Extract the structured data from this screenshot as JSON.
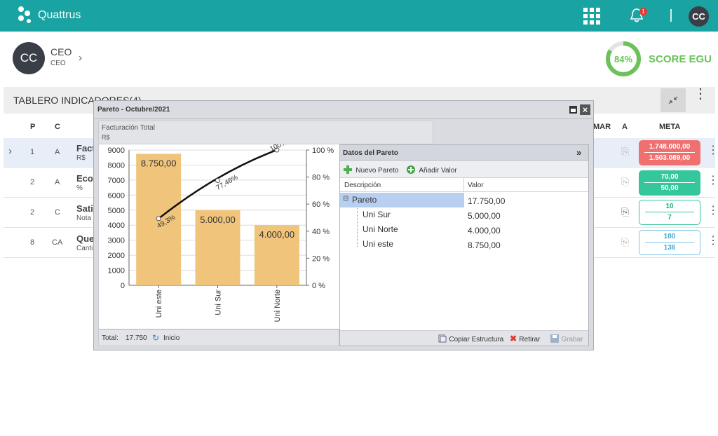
{
  "topbar": {
    "app_name": "Quattrus",
    "notification_count": "1",
    "user_initials": "CC"
  },
  "profile": {
    "initials": "CC",
    "name": "CEO",
    "role": "CEO",
    "chevron": "›"
  },
  "score": {
    "value": "84%",
    "label": "SCORE EGU",
    "fraction": 0.84,
    "color": "#6ac259"
  },
  "dashboard": {
    "title": "TABLERO INDICADORES(4)"
  },
  "table": {
    "headers": {
      "p": "P",
      "c": "C",
      "mar": "MAR",
      "a": "A",
      "meta": "META"
    },
    "rows": [
      {
        "expand": "›",
        "p": "1",
        "c": "A",
        "name": "Fact",
        "unit": "R$",
        "meta_top": "1.748.000,00",
        "meta_bottom": "1.503.089,00"
      },
      {
        "p": "2",
        "c": "A",
        "name": "Econ",
        "unit": "%",
        "meta_top": "70,00",
        "meta_bottom": "50,00"
      },
      {
        "p": "2",
        "c": "C",
        "name": "Satis",
        "unit": "Nota",
        "meta_top": "10",
        "meta_bottom": "7"
      },
      {
        "p": "8",
        "c": "CA",
        "name": "Quej",
        "unit": "Canti",
        "meta_top": "180",
        "meta_bottom": "136"
      }
    ]
  },
  "modal": {
    "title": "Pareto - Octubre/2021",
    "chart_title": "Facturación Total",
    "chart_unit": "R$",
    "footer_total_label": "Total:",
    "footer_total_value": "17.750",
    "footer_inicio": "Inicio",
    "panel": {
      "title": "Datos del Pareto",
      "collapse": "»",
      "btn_new": "Nuevo Pareto",
      "btn_add": "Añadir Valor",
      "col_desc": "Descripción",
      "col_val": "Valor",
      "tree": [
        {
          "label": "Pareto",
          "value": "17.750,00"
        },
        {
          "label": "Uni Sur",
          "value": "5.000,00"
        },
        {
          "label": "Uni Norte",
          "value": "4.000,00"
        },
        {
          "label": "Uni este",
          "value": "8.750,00"
        }
      ],
      "btn_copy": "Copiar Estructura",
      "btn_remove": "Retirar",
      "btn_save": "Grabar"
    }
  },
  "chart_data": {
    "type": "bar",
    "categories": [
      "Uni este",
      "Uni Sur",
      "Uni Norte"
    ],
    "values": [
      8750,
      5000,
      4000
    ],
    "value_labels": [
      "8.750,00",
      "5.000,00",
      "4.000,00"
    ],
    "cumulative_pct": [
      49.3,
      77.46,
      100
    ],
    "cumulative_labels": [
      "49,3%",
      "77,46%",
      "100%"
    ],
    "ylim": [
      0,
      9000
    ],
    "yticks": [
      "0",
      "1000",
      "2000",
      "3000",
      "4000",
      "5000",
      "6000",
      "7000",
      "8000",
      "9000"
    ],
    "y2ticks": [
      "0 %",
      "20 %",
      "40 %",
      "60 %",
      "80 %",
      "100 %"
    ],
    "bar_color": "#f0c47a",
    "grid": true
  }
}
